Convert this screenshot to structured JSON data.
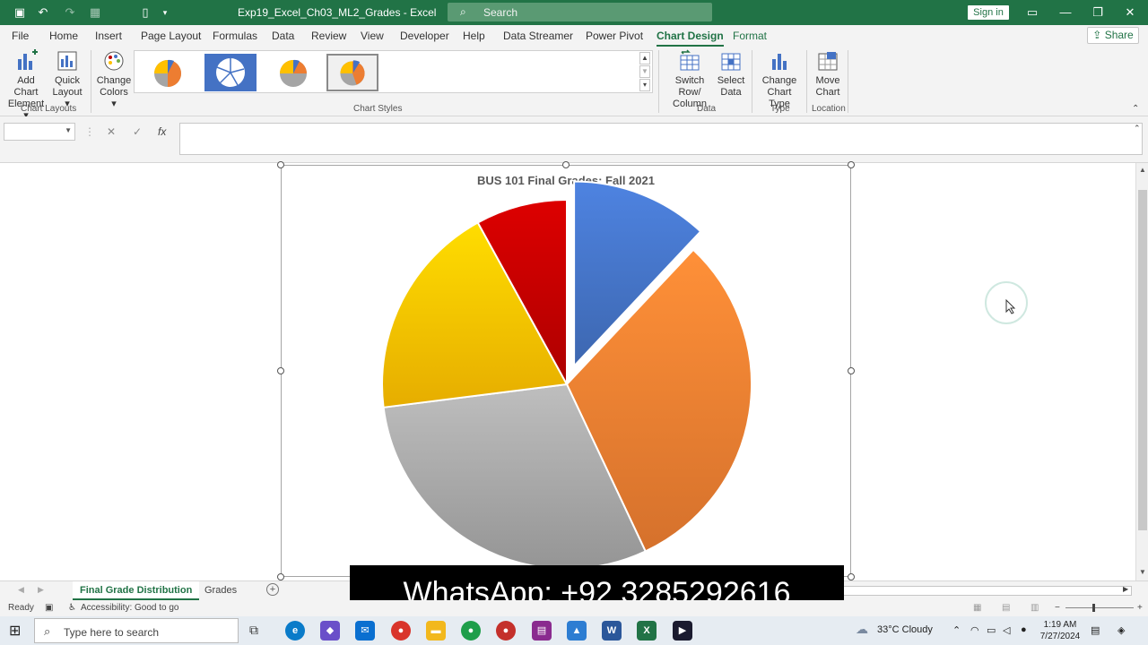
{
  "titlebar": {
    "doc_title": "Exp19_Excel_Ch03_ML2_Grades  -  Excel",
    "search_placeholder": "Search",
    "signin_label": "Sign in"
  },
  "menu": {
    "tabs": [
      "File",
      "Home",
      "Insert",
      "Page Layout",
      "Formulas",
      "Data",
      "Review",
      "View",
      "Developer",
      "Help",
      "Data Streamer",
      "Power Pivot",
      "Chart Design",
      "Format"
    ],
    "active_tab": "Chart Design",
    "share_label": "Share"
  },
  "ribbon": {
    "add_chart_element": [
      "Add Chart",
      "Element"
    ],
    "quick_layout": [
      "Quick",
      "Layout"
    ],
    "change_colors": [
      "Change",
      "Colors"
    ],
    "chart_layouts_label": "Chart Layouts",
    "chart_styles_label": "Chart Styles",
    "switch_row_col": [
      "Switch Row/",
      "Column"
    ],
    "select_data": [
      "Select",
      "Data"
    ],
    "data_label": "Data",
    "change_chart_type": [
      "Change",
      "Chart Type"
    ],
    "type_label": "Type",
    "move_chart": [
      "Move",
      "Chart"
    ],
    "location_label": "Location"
  },
  "formula_bar": {
    "cancel_icon": "✕",
    "enter_icon": "✓",
    "fx_label": "fx",
    "value": ""
  },
  "chart_data": {
    "type": "pie",
    "title": "BUS 101 Final Grades: Fall 2021",
    "values": [
      12,
      31,
      30,
      19,
      8
    ],
    "colors": [
      "#4472c4",
      "#ed7d31",
      "#a5a5a5",
      "#ffc000",
      "#c00000"
    ],
    "exploded_index": 0
  },
  "sheet_tabs": {
    "tabs": [
      "Final Grade Distribution",
      "Grades"
    ],
    "active": "Final Grade Distribution"
  },
  "overlay": {
    "whatsapp": "WhatsApp: +92 3285292616"
  },
  "statusbar": {
    "ready": "Ready",
    "accessibility": "Accessibility: Good to go"
  },
  "taskbar": {
    "search_placeholder": "Type here to search",
    "weather": "33°C  Cloudy",
    "time": "1:19 AM",
    "date": "7/27/2024"
  }
}
